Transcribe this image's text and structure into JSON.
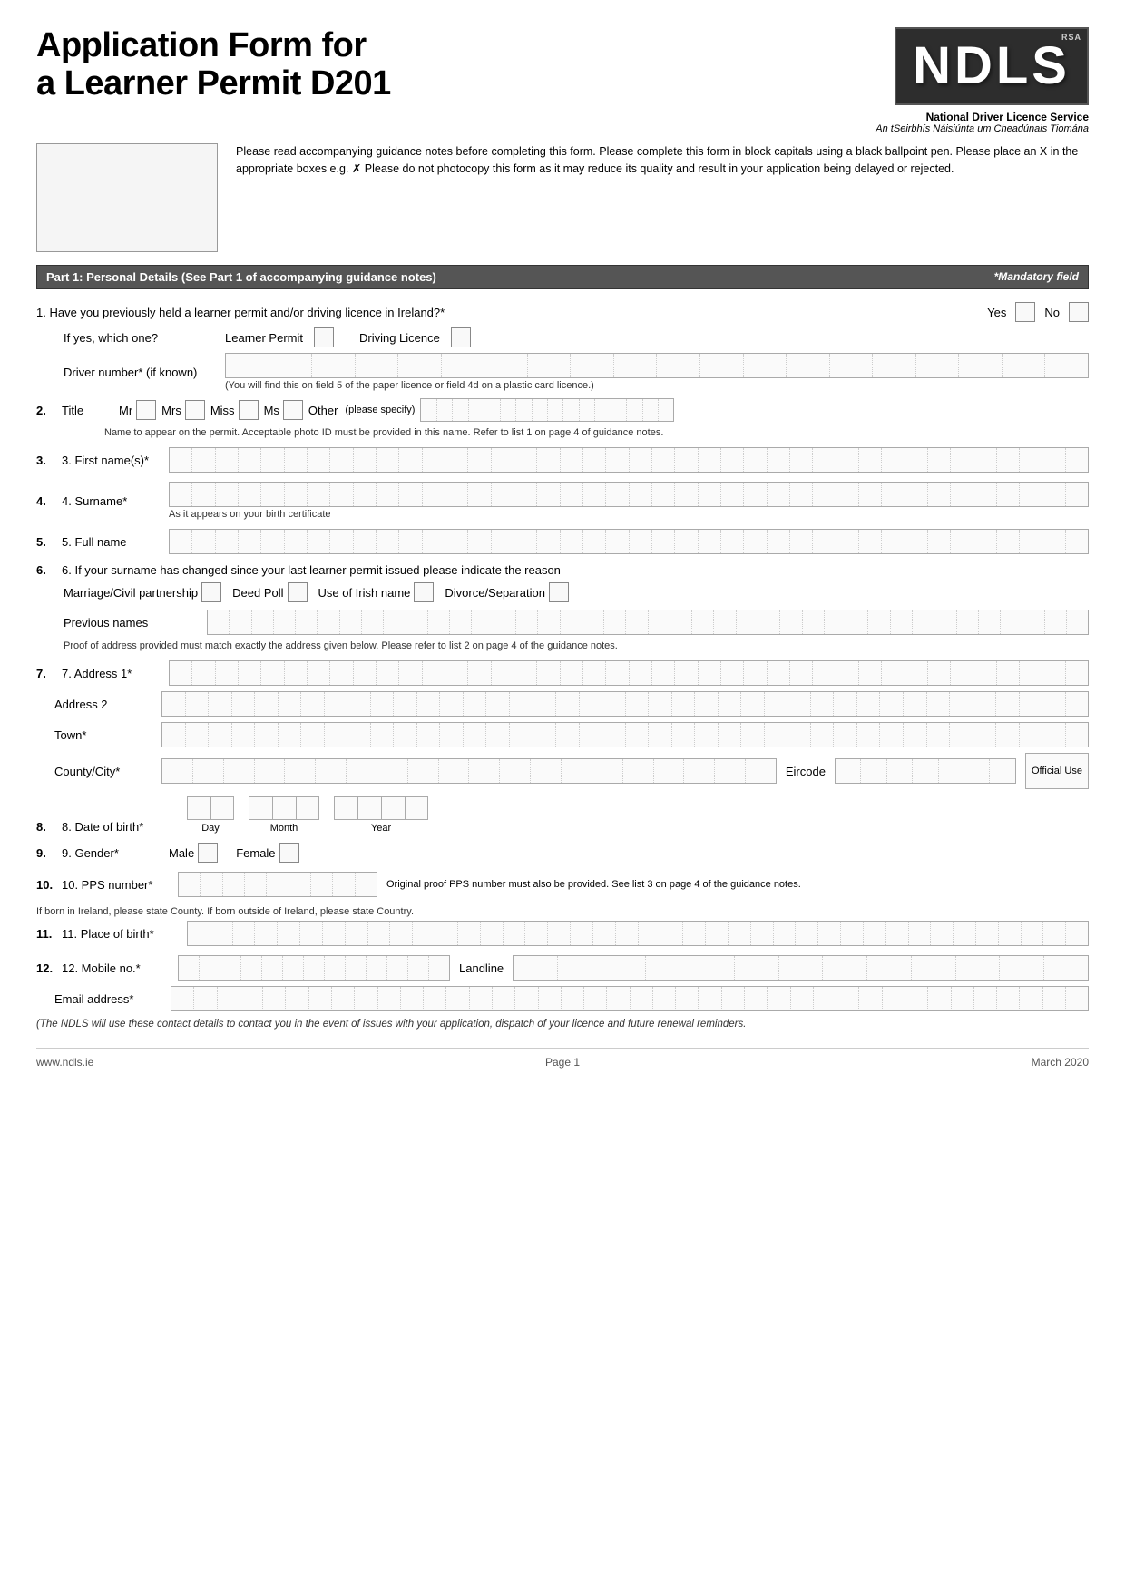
{
  "page": {
    "title_line1": "Application Form for",
    "title_line2": "a Learner Permit D201",
    "rsa_badge": "RSA",
    "ndls_logo": "NDLS",
    "ndls_name_en": "National Driver Licence Service",
    "ndls_name_ga": "An tSeirbhís Náisiúnta um Cheadúnais Tiomána",
    "section1_label": "Part 1: Personal Details",
    "section1_note": "(See Part 1 of accompanying guidance notes)",
    "mandatory_label": "*Mandatory field",
    "instructions": "Please read accompanying guidance notes before completing this form. Please complete this form in block capitals using a black ballpoint pen. Please place an X in the appropriate boxes e.g. ✗  Please do not photocopy this form as it may reduce its quality and result in your application being delayed or rejected.",
    "q1_text": "1.  Have you previously held a learner permit and/or driving licence in Ireland?*",
    "q1_yes": "Yes",
    "q1_no": "No",
    "q1_ifyes": "If yes, which one?",
    "q1_learner": "Learner Permit",
    "q1_driving": "Driving Licence",
    "q1_driver_number_label": "Driver number* (if known)",
    "q1_driver_hint": "(You will find this on field 5 of the paper licence or field 4d on a plastic card licence.)",
    "q2_label": "2.  Title",
    "q2_mr": "Mr",
    "q2_mrs": "Mrs",
    "q2_miss": "Miss",
    "q2_ms": "Ms",
    "q2_other": "Other",
    "q2_other_specify": "(please specify)",
    "q2_hint": "Name to appear on the permit. Acceptable photo ID must be provided in this name. Refer to list 1 on page 4 of guidance notes.",
    "q3_label": "3.  First name(s)*",
    "q4_label": "4.  Surname*",
    "q4_hint": "As it appears on your birth certificate",
    "q5_label": "5.  Full name",
    "q6_label": "6.  If your surname has changed since your last learner permit issued please indicate the reason",
    "q6_marriage": "Marriage/Civil partnership",
    "q6_deed": "Deed Poll",
    "q6_irish": "Use of Irish name",
    "q6_divorce": "Divorce/Separation",
    "q6_prev_names": "Previous names",
    "q6_proof_hint": "Proof of address provided must match exactly the address given below. Please refer to list 2 on page 4 of the guidance notes.",
    "q7_label": "7.  Address 1*",
    "q7_addr2": "Address 2",
    "q7_town": "Town*",
    "q7_county": "County/City*",
    "q7_eircode": "Eircode",
    "q7_official_use": "Official Use",
    "q8_label": "8.  Date of birth*",
    "q8_day": "Day",
    "q8_month": "Month",
    "q8_year": "Year",
    "q9_label": "9.  Gender*",
    "q9_male": "Male",
    "q9_female": "Female",
    "q10_label": "10. PPS number*",
    "q10_hint": "Original proof PPS number must also be provided. See list 3 on page 4 of the guidance notes.",
    "q11_label": "11. Place of birth*",
    "q11_hint": "If born in Ireland, please state County. If born outside of Ireland, please state Country.",
    "q12_label": "12. Mobile no.*",
    "q12_landline": "Landline",
    "q12_email": "Email address*",
    "q12_notice": "(The NDLS will use these contact details to contact you in the event of issues with your application, dispatch of your licence and future renewal reminders.",
    "footer_website": "www.ndls.ie",
    "footer_page": "Page 1",
    "footer_date": "March 2020"
  }
}
